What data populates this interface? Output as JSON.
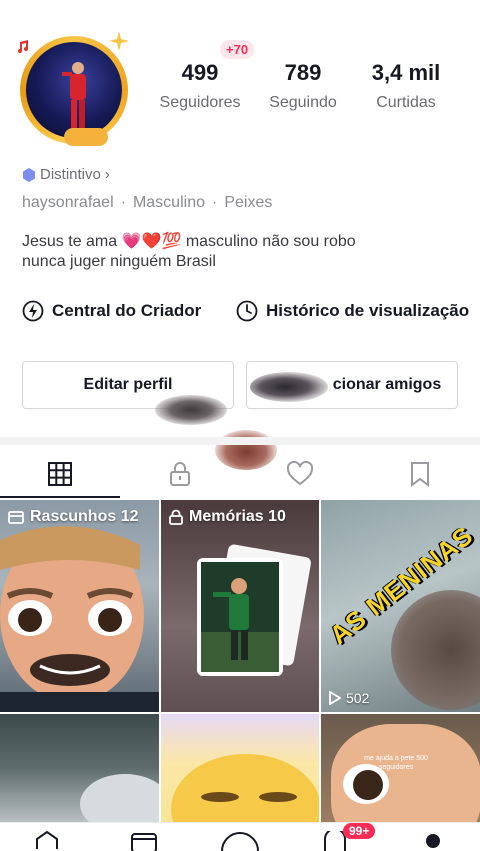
{
  "profile": {
    "stats": [
      {
        "value": "499",
        "label": "Seguidores"
      },
      {
        "value": "789",
        "label": "Seguindo"
      },
      {
        "value": "3,4 mil",
        "label": "Curtidas"
      }
    ],
    "new_followers_badge": "+70",
    "distintivo": "Distintivo",
    "meta": [
      "haysonrafael",
      "·",
      "Masculino",
      "·",
      "Peixes"
    ],
    "bio_line1": "Jesus te ama 💗❤️💯   masculino não sou robo",
    "bio_line2": "nunca juger ninguém Brasil"
  },
  "quick_links": {
    "creator": "Central do Criador",
    "history": "Histórico de visualização"
  },
  "buttons": {
    "edit": "Editar perfil",
    "add_friends": "cionar amigos"
  },
  "grid": {
    "drafts": "Rascunhos 12",
    "memories": "Memórias 10",
    "as_meninas_caption": "AS MENINAS",
    "views": "502",
    "bottom_right_caption": "me ajuda a pete 500 seguidores"
  },
  "nav": {
    "inbox_badge": "99+"
  },
  "colors": {
    "accent": "#fe2c55",
    "text": "#161823",
    "muted": "#8a8b91"
  }
}
